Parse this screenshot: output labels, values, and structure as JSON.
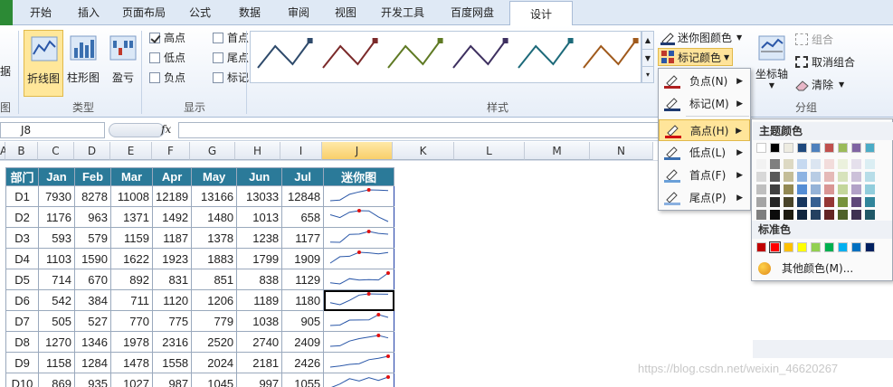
{
  "tabs": [
    "开始",
    "插入",
    "页面布局",
    "公式",
    "数据",
    "审阅",
    "视图",
    "开发工具",
    "百度网盘",
    "设计"
  ],
  "ribbon": {
    "edit_data_partial": "据",
    "type_buttons": [
      "折线图",
      "柱形图",
      "盈亏"
    ],
    "type_group": "类型",
    "show_checkboxes": [
      {
        "label": "高点",
        "checked": true
      },
      {
        "label": "首点",
        "checked": false
      },
      {
        "label": "低点",
        "checked": false
      },
      {
        "label": "尾点",
        "checked": false
      },
      {
        "label": "负点",
        "checked": false
      },
      {
        "label": "标记",
        "checked": false
      }
    ],
    "show_group": "显示",
    "style_group": "样式",
    "sparkline_color": "迷你图颜色",
    "marker_color": "标记颜色",
    "axis_button": "坐标轴",
    "group_button": "组合",
    "ungroup_button": "取消组合",
    "clear_button": "清除",
    "group_group": "分组",
    "left_group_partial": "图",
    "gallery_colors": [
      "#2e4a6b",
      "#7b2a2a",
      "#5f7a24",
      "#3e3060",
      "#1d6a7a",
      "#a05a1c"
    ]
  },
  "formula_bar": {
    "name_box": "J8",
    "fx": "fx"
  },
  "columns": [
    "A",
    "B",
    "C",
    "D",
    "E",
    "F",
    "G",
    "H",
    "I",
    "J",
    "K",
    "L",
    "M",
    "N"
  ],
  "table": {
    "headers": [
      "部门",
      "Jan",
      "Feb",
      "Mar",
      "Apr",
      "May",
      "Jun",
      "Jul",
      "迷你图"
    ],
    "rows": [
      {
        "dept": "D1",
        "vals": [
          7930,
          8278,
          11008,
          12189,
          13166,
          13033,
          12848
        ]
      },
      {
        "dept": "D2",
        "vals": [
          1176,
          963,
          1371,
          1492,
          1480,
          1013,
          658
        ]
      },
      {
        "dept": "D3",
        "vals": [
          593,
          579,
          1159,
          1187,
          1378,
          1238,
          1177
        ]
      },
      {
        "dept": "D4",
        "vals": [
          1103,
          1590,
          1622,
          1923,
          1883,
          1799,
          1909
        ]
      },
      {
        "dept": "D5",
        "vals": [
          714,
          670,
          892,
          831,
          851,
          838,
          1129
        ]
      },
      {
        "dept": "D6",
        "vals": [
          542,
          384,
          711,
          1120,
          1206,
          1189,
          1180
        ]
      },
      {
        "dept": "D7",
        "vals": [
          505,
          527,
          770,
          775,
          779,
          1038,
          905
        ]
      },
      {
        "dept": "D8",
        "vals": [
          1270,
          1346,
          1978,
          2316,
          2520,
          2740,
          2409
        ]
      },
      {
        "dept": "D9",
        "vals": [
          1158,
          1284,
          1478,
          1558,
          2024,
          2181,
          2426
        ]
      },
      {
        "dept": "D10",
        "vals": [
          869,
          935,
          1027,
          987,
          1045,
          997,
          1055
        ]
      }
    ]
  },
  "marker_menu": {
    "items": [
      "负点(N)",
      "标记(M)",
      "高点(H)",
      "低点(L)",
      "首点(F)",
      "尾点(P)"
    ],
    "pen_colors": [
      "#b02020",
      "#1f3a70",
      "#d01010",
      "#3a6fb0",
      "#6aa0d8",
      "#8ab0e0"
    ]
  },
  "color_menu": {
    "theme_header": "主题颜色",
    "theme_top": [
      "#ffffff",
      "#000000",
      "#eeece1",
      "#1f497d",
      "#4f81bd",
      "#c0504d",
      "#9bbb59",
      "#8064a2",
      "#4bacc6"
    ],
    "theme_shades": [
      [
        "#f2f2f2",
        "#7f7f7f",
        "#ddd9c3",
        "#c6d9f0",
        "#dbe5f1",
        "#f2dcdb",
        "#ebf1dd",
        "#e5e0ec",
        "#dbeef3"
      ],
      [
        "#d8d8d8",
        "#595959",
        "#c4bd97",
        "#8db3e2",
        "#b8cce4",
        "#e5b9b7",
        "#d7e3bc",
        "#ccc1d9",
        "#b7dde8"
      ],
      [
        "#bfbfbf",
        "#3f3f3f",
        "#938953",
        "#548dd4",
        "#95b3d7",
        "#d99694",
        "#c3d69b",
        "#b2a2c7",
        "#92cddc"
      ],
      [
        "#a5a5a5",
        "#262626",
        "#494429",
        "#17365d",
        "#366092",
        "#953734",
        "#76923c",
        "#5f497a",
        "#31859b"
      ],
      [
        "#7f7f7f",
        "#0c0c0c",
        "#1d1b10",
        "#0f243e",
        "#244061",
        "#632423",
        "#4f6128",
        "#3f3151",
        "#205867"
      ]
    ],
    "standard_header": "标准色",
    "standard": [
      "#c00000",
      "#ff0000",
      "#ffc000",
      "#ffff00",
      "#92d050",
      "#00b050",
      "#00b0f0",
      "#0070c0",
      "#002060"
    ],
    "more_colors": "其他颜色(M)..."
  },
  "watermark": "https://blog.csdn.net/weixin_46620267"
}
